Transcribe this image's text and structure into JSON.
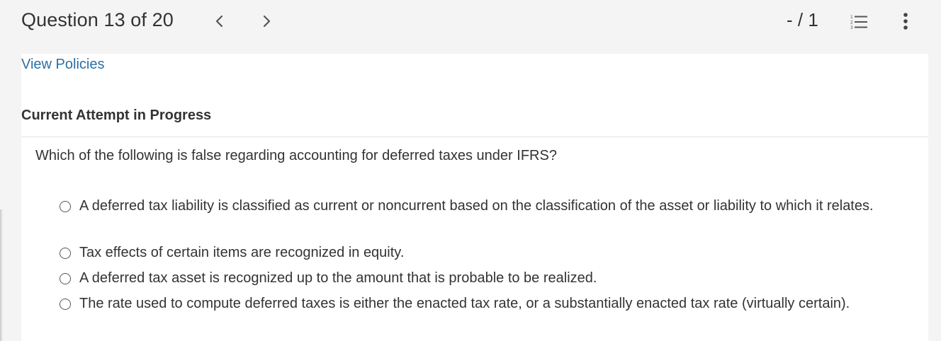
{
  "header": {
    "question_counter": "Question 13 of 20",
    "score": "- / 1",
    "prev_icon": "chevron-left-icon",
    "next_icon": "chevron-right-icon",
    "list_icon": "numbered-list-icon",
    "more_icon": "vertical-ellipsis-icon"
  },
  "links": {
    "view_policies": "View Policies"
  },
  "attempt": {
    "heading": "Current Attempt in Progress"
  },
  "question": {
    "text": "Which of the following is false regarding accounting for deferred taxes under IFRS?",
    "options": [
      {
        "label": "A deferred tax liability is classified as current or noncurrent based on the classification of the asset or liability to which it relates."
      },
      {
        "label": "Tax effects of certain items are recognized in equity."
      },
      {
        "label": "A deferred tax asset is recognized up to the amount that is probable to be realized."
      },
      {
        "label": "The rate used to compute deferred taxes is either the enacted tax rate, or a substantially enacted tax rate (virtually certain)."
      }
    ]
  },
  "colors": {
    "link": "#2a6fa8",
    "text": "#333333",
    "background": "#f4f4f4",
    "card": "#ffffff"
  }
}
